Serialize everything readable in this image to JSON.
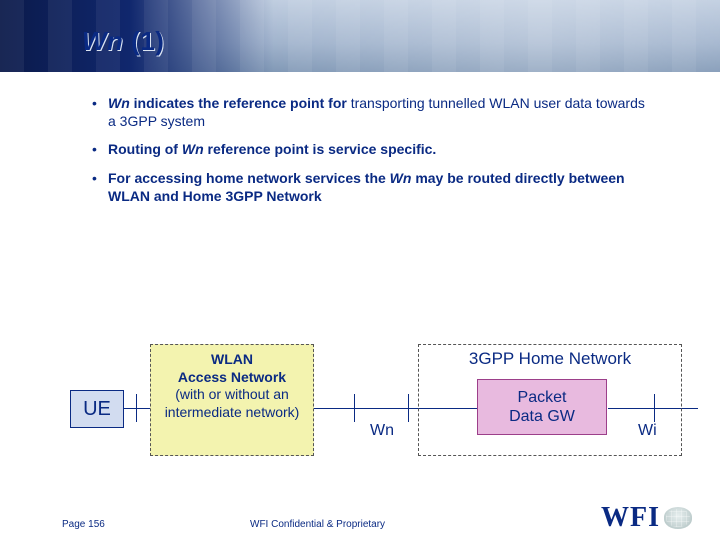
{
  "header": {
    "title_prefix": "Wn",
    "title_suffix": "(1)"
  },
  "bullets": {
    "b1_bold_part": "indicates the reference point for",
    "b1_italic": "Wn",
    "b1_rest": " transporting tunnelled WLAN user data towards a 3GPP system",
    "b2_pre": "Routing of ",
    "b2_italic": "Wn",
    "b2_post": " reference point is service specific.",
    "b3_pre": "For accessing home network services the ",
    "b3_italic": "Wn",
    "b3_post": " may be routed directly between WLAN and Home 3GPP Network"
  },
  "diagram": {
    "ue": "UE",
    "wlan_bold_line1": "WLAN",
    "wlan_bold_line2": "Access Network",
    "wlan_rest": "(with or without an intermediate network)",
    "home_title": "3GPP Home Network",
    "pdg_line1": "Packet",
    "pdg_line2": "Data GW",
    "wn_label": "Wn",
    "wi_label": "Wi"
  },
  "footer": {
    "page": "Page 156",
    "confidential": "WFI Confidential & Proprietary",
    "logo_text": "WFI"
  }
}
